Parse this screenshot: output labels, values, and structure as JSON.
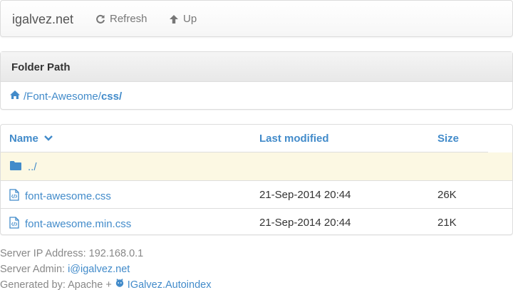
{
  "navbar": {
    "brand": "igalvez.net",
    "refresh_label": "Refresh",
    "up_label": "Up"
  },
  "path_panel": {
    "heading": "Folder Path",
    "path_prefix": "/Font-Awesome/",
    "path_current": "css/"
  },
  "listing": {
    "columns": {
      "name": "Name",
      "modified": "Last modified",
      "size": "Size"
    },
    "sort_icon": "chevron-down-icon",
    "parent": {
      "name": "../"
    },
    "files": [
      {
        "name": "font-awesome.css",
        "modified": "21-Sep-2014 20:44",
        "size": "26K"
      },
      {
        "name": "font-awesome.min.css",
        "modified": "21-Sep-2014 20:44",
        "size": "21K"
      }
    ]
  },
  "footer": {
    "ip_label": "Server IP Address: 192.168.0.1",
    "admin_label": "Server Admin:",
    "admin_email": "i@igalvez.net",
    "generated_label": "Generated by: Apache +",
    "generator_link": "IGalvez.Autoindex"
  },
  "colors": {
    "link": "#428bca",
    "parent_row_bg": "#fcf8e3"
  }
}
